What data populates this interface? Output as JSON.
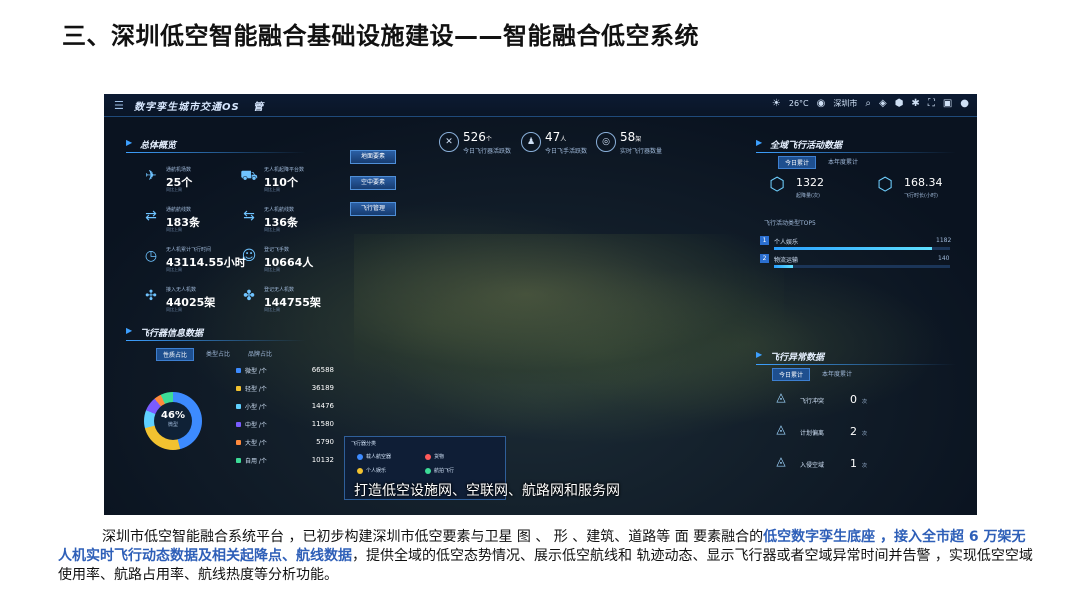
{
  "slide": {
    "title": "三、深圳低空智能融合基础设施建设——智能融合低空系统",
    "caption_normal_1": "深圳市低空智能融合系统平台 ，已初步构建深圳市低空要素与卫星   图 、   形 、建筑、道路等   面 要素融合的",
    "caption_hl_1": "低空数字孪生底座 ，接入全市超 6 万架无人机实时飞行动态数据及相关起降点、航线数据",
    "caption_normal_2": "，提供全域的低空态势情况、展示低空航线和 轨迹动态、显示飞行器或者空域异常时间并告警 ，实现低空空域使用率、航路占用率、航线热度等分析功能。"
  },
  "screen": {
    "app_title": "数字孪生城市交通OS",
    "app_suffix": "管",
    "weather": "26°C",
    "city": "深圳市",
    "kpis": [
      {
        "value": "526",
        "unit": "个",
        "label": "今日飞行器活跃数",
        "icon": "cross-circle-icon"
      },
      {
        "value": "47",
        "unit": "人",
        "label": "今日飞手活跃数",
        "icon": "user-icon"
      },
      {
        "value": "58",
        "unit": "架",
        "label": "实时飞行器数量",
        "icon": "eye-icon"
      }
    ],
    "layer_buttons": [
      "地面要素",
      "空中要素",
      "飞行管理"
    ],
    "overview": {
      "title": "总体概览",
      "stats": [
        {
          "label": "通航机场数",
          "value": "25个",
          "sub": "同比上周",
          "icon": "airplane-icon"
        },
        {
          "label": "无人机起降平台数",
          "value": "110个",
          "sub": "同比上周",
          "icon": "drone-pad-icon"
        },
        {
          "label": "通航航线数",
          "value": "183条",
          "sub": "同比上周",
          "icon": "route-icon"
        },
        {
          "label": "无人机航线数",
          "value": "136条",
          "sub": "同比上周",
          "icon": "drone-route-icon"
        },
        {
          "label": "无人机累计飞行时间",
          "value": "43114.55小时",
          "sub": "同比上周",
          "icon": "clock-icon"
        },
        {
          "label": "登记飞手数",
          "value": "10664人",
          "sub": "同比上周",
          "icon": "pilot-icon"
        },
        {
          "label": "接入无人机数",
          "value": "44025架",
          "sub": "同比上周",
          "icon": "drone-icon"
        },
        {
          "label": "登记无人机数",
          "value": "144755架",
          "sub": "同比上周",
          "icon": "registry-icon"
        }
      ]
    },
    "aircraft_info": {
      "title": "飞行器信息数据",
      "tabs": [
        "性质占比",
        "类型占比",
        "品牌占比"
      ],
      "donut_pct": "46%",
      "donut_caption": "微型",
      "types": [
        {
          "label": "微型 /个",
          "value": "66588",
          "color": "#3d8bff"
        },
        {
          "label": "轻型 /个",
          "value": "36189",
          "color": "#f2c230"
        },
        {
          "label": "小型 /个",
          "value": "14476",
          "color": "#5fd0ff"
        },
        {
          "label": "中型 /个",
          "value": "11580",
          "color": "#7a5cff"
        },
        {
          "label": "大型 /个",
          "value": "5790",
          "color": "#ff8a3d"
        },
        {
          "label": "自用 /个",
          "value": "10132",
          "color": "#3ddc97"
        }
      ]
    },
    "activity": {
      "title": "全域飞行活动数据",
      "tabs": [
        "今日累计",
        "本年度累计"
      ],
      "metrics": [
        {
          "value": "1322",
          "label": "起降量(次)",
          "icon": "takeoff-icon"
        },
        {
          "value": "168.34",
          "label": "飞行时长(小时)",
          "icon": "duration-icon"
        }
      ],
      "rank_title": "飞行活动类型TOP5",
      "ranks": [
        {
          "num": "1",
          "label": "个人娱乐",
          "value": "1182",
          "fill": 0.9
        },
        {
          "num": "2",
          "label": "物流运输",
          "value": "140",
          "fill": 0.11
        }
      ]
    },
    "anomaly": {
      "title": "飞行异常数据",
      "tabs": [
        "今日累计",
        "本年度累计"
      ],
      "rows": [
        {
          "label": "飞行冲突",
          "value": "0",
          "unit": "次",
          "icon": "conflict-icon"
        },
        {
          "label": "计划偏离",
          "value": "2",
          "unit": "次",
          "icon": "deviation-icon"
        },
        {
          "label": "入侵空域",
          "value": "1",
          "unit": "次",
          "icon": "intrusion-icon"
        }
      ]
    },
    "legend": {
      "title": "飞行器分类",
      "items": [
        {
          "label": "载人航空器",
          "color": "#3d8bff"
        },
        {
          "label": "货物",
          "color": "#ff5a5a"
        },
        {
          "label": "个人娱乐",
          "color": "#f2c230"
        },
        {
          "label": "航拍飞行",
          "color": "#3ddc97"
        }
      ]
    },
    "subtitle": "打造低空设施网、空联网、航路网和服务网"
  },
  "colors": {
    "accent": "#3da0ff",
    "highlight_text": "#2e5fb8",
    "panel_bg": "#0a1526"
  }
}
